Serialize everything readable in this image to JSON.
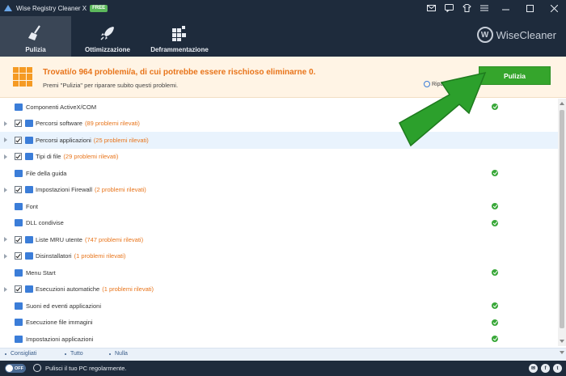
{
  "app": {
    "title": "Wise Registry Cleaner X",
    "badge": "FREE"
  },
  "window_controls": {
    "icons": [
      "mail-icon",
      "chat-icon",
      "shirt-icon",
      "menu-icon",
      "minimize-icon",
      "maximize-icon",
      "close-icon"
    ]
  },
  "header": {
    "tabs": [
      {
        "label": "Pulizia",
        "icon": "broom-icon",
        "active": true
      },
      {
        "label": "Ottimizzazione",
        "icon": "rocket-icon",
        "active": false
      },
      {
        "label": "Deframmentazione",
        "icon": "defrag-icon",
        "active": false
      }
    ],
    "brand": "WiseCleaner",
    "brand_letter": "W"
  },
  "banner": {
    "title": "Trovati/o 964 problemi/a, di cui potrebbe essere rischioso eliminarne 0.",
    "subtitle": "Premi \"Pulizia\" per riparare subito questi problemi.",
    "restore_label": "Ripara",
    "clean_button": "Pulizia",
    "accent_color": "#e8741a"
  },
  "items": [
    {
      "label": "Componenti ActiveX/COM",
      "count": "",
      "expandable": false,
      "checkbox": false,
      "ok": true,
      "icon_color": "#3b7dd8"
    },
    {
      "label": "Percorsi software",
      "count": "(89 problemi rilevati)",
      "expandable": true,
      "checkbox": true,
      "ok": false,
      "icon_color": "#3b7dd8"
    },
    {
      "label": "Percorsi applicazioni",
      "count": "(25 problemi rilevati)",
      "expandable": true,
      "checkbox": true,
      "ok": false,
      "icon_color": "#3b7dd8",
      "highlight": true
    },
    {
      "label": "Tipi di file",
      "count": "(29 problemi rilevati)",
      "expandable": true,
      "checkbox": true,
      "ok": false,
      "icon_color": "#3b7dd8"
    },
    {
      "label": "File della guida",
      "count": "",
      "expandable": false,
      "checkbox": false,
      "ok": true,
      "icon_color": "#3b7dd8"
    },
    {
      "label": "Impostazioni Firewall",
      "count": "(2 problemi rilevati)",
      "expandable": true,
      "checkbox": true,
      "ok": false,
      "icon_color": "#3b7dd8"
    },
    {
      "label": "Font",
      "count": "",
      "expandable": false,
      "checkbox": false,
      "ok": true,
      "icon_color": "#3b7dd8"
    },
    {
      "label": "DLL condivise",
      "count": "",
      "expandable": false,
      "checkbox": false,
      "ok": true,
      "icon_color": "#3b7dd8"
    },
    {
      "label": "Liste MRU utente",
      "count": "(747 problemi rilevati)",
      "expandable": true,
      "checkbox": true,
      "ok": false,
      "icon_color": "#3b7dd8"
    },
    {
      "label": "Disinstallatori",
      "count": "(1 problemi rilevati)",
      "expandable": true,
      "checkbox": true,
      "ok": false,
      "icon_color": "#3b7dd8"
    },
    {
      "label": "Menu Start",
      "count": "",
      "expandable": false,
      "checkbox": false,
      "ok": true,
      "icon_color": "#3b7dd8"
    },
    {
      "label": "Esecuzioni automatiche",
      "count": "(1 problemi rilevati)",
      "expandable": true,
      "checkbox": true,
      "ok": false,
      "icon_color": "#3b7dd8"
    },
    {
      "label": "Suoni ed eventi applicazioni",
      "count": "",
      "expandable": false,
      "checkbox": false,
      "ok": true,
      "icon_color": "#3b7dd8"
    },
    {
      "label": "Esecuzione file immagini",
      "count": "",
      "expandable": false,
      "checkbox": false,
      "ok": true,
      "icon_color": "#3b7dd8"
    },
    {
      "label": "Impostazioni applicazioni",
      "count": "",
      "expandable": false,
      "checkbox": false,
      "ok": true,
      "icon_color": "#3b7dd8"
    }
  ],
  "filters": [
    "Consigliati",
    "Tutto",
    "Nulla"
  ],
  "status": {
    "toggle_label": "OFF",
    "text": "Pulisci il tuo PC regolarmente.",
    "social": [
      "mail-icon",
      "facebook-icon",
      "twitter-icon"
    ]
  },
  "colors": {
    "dark": "#1e2b3c",
    "active_tab": "#3a4656",
    "green_button": "#35a52c",
    "arrow": "#2ca02c"
  }
}
